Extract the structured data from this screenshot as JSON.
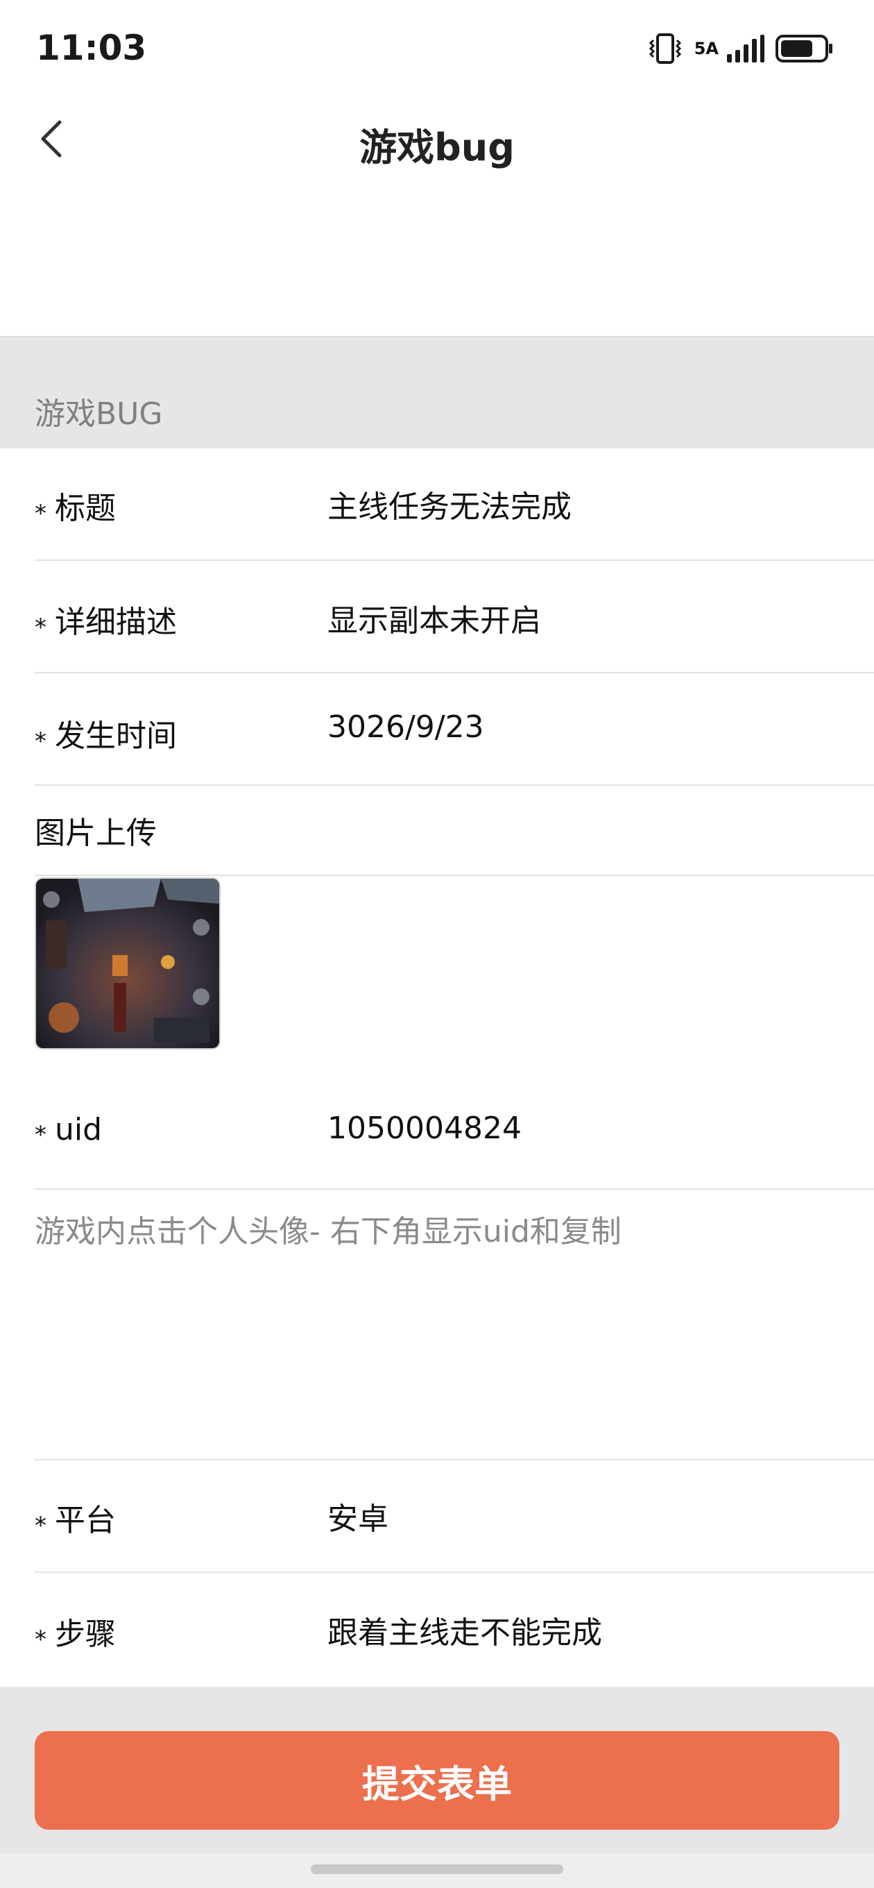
{
  "status_bar": {
    "time": "11:03",
    "network": "5A",
    "battery_level": 0.75
  },
  "nav": {
    "title": "游戏bug",
    "back_icon": "chevron-left-icon"
  },
  "section": {
    "header": "游戏BUG"
  },
  "form": {
    "required_mark": "*",
    "rows": [
      {
        "label": "标题",
        "value": "主线任务无法完成",
        "required": true
      },
      {
        "label": "详细描述",
        "value": "显示副本未开启",
        "required": true
      },
      {
        "label": "发生时间",
        "value": "3026/9/23",
        "required": true
      }
    ],
    "image_upload_label": "图片上传",
    "uid": {
      "label": "uid",
      "value": "1050004824",
      "required": true
    },
    "uid_hint": "游戏内点击个人头像- 右下角显示uid和复制",
    "platform": {
      "label": "平台",
      "value": "安卓",
      "required": true
    },
    "steps": {
      "label": "步骤",
      "value": "跟着主线走不能完成",
      "required": true
    }
  },
  "submit": {
    "label": "提交表单"
  },
  "colors": {
    "accent": "#ec6f4e",
    "section_bg": "#e6e6e6",
    "hint_text": "#8a8a8a"
  }
}
